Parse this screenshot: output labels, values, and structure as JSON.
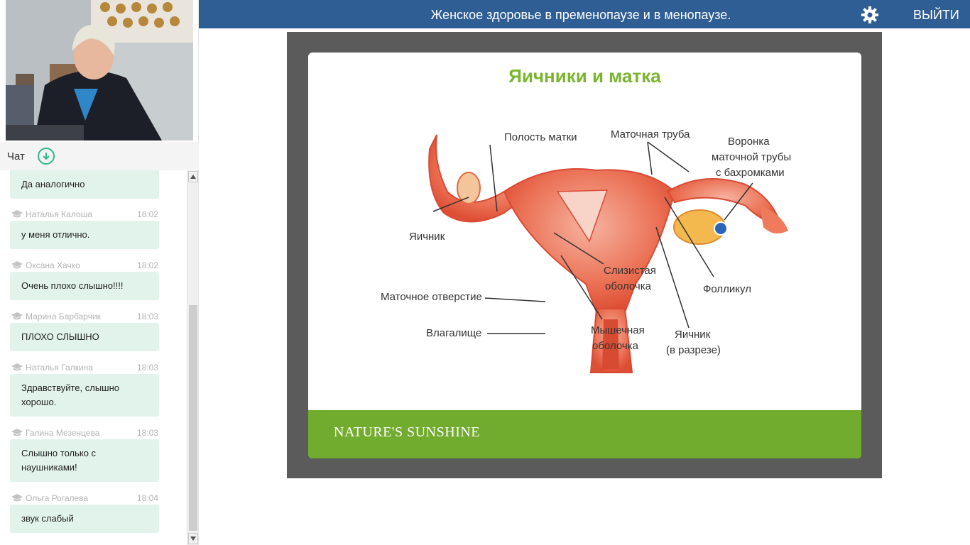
{
  "header": {
    "title": "Женское здоровье в пременопаузе и в менопаузе.",
    "logout_label": "ВЫЙТИ",
    "settings_icon": "gear-icon"
  },
  "chat": {
    "title": "Чат",
    "messages": [
      {
        "author": "",
        "time": "",
        "text": "Да аналогично"
      },
      {
        "author": "Наталья Калоша",
        "time": "18:02",
        "text": "у меня отлично."
      },
      {
        "author": "Оксана Хачко",
        "time": "18:02",
        "text": "Очень плохо слышно!!!!"
      },
      {
        "author": "Марина Барбарчик",
        "time": "18:03",
        "text": "ПЛОХО СЛЫШНО"
      },
      {
        "author": "Наталья Галкина",
        "time": "18:03",
        "text": "Здравствуйте, слышно хорошо."
      },
      {
        "author": "Галина Мезенцева",
        "time": "18:03",
        "text": "Слышно только с наушниками!"
      },
      {
        "author": "Ольга Рогалева",
        "time": "18:04",
        "text": "звук слабый"
      }
    ]
  },
  "slide": {
    "title": "Яичники и матка",
    "labels": {
      "cavity": "Полость матки",
      "tube": "Маточная труба",
      "funnel_1": "Воронка",
      "funnel_2": "маточной трубы",
      "funnel_3": "с бахромками",
      "ovary": "Яичник",
      "mucosa_1": "Слизистая",
      "mucosa_2": "оболочка",
      "follicle": "Фолликул",
      "opening": "Маточное отверстие",
      "vagina": "Влагалище",
      "muscle_1": "Мышечная",
      "muscle_2": "оболочка",
      "ovary_cut_1": "Яичник",
      "ovary_cut_2": "(в разрезе)"
    },
    "brand": "NATURE'S SUNSHINE",
    "brand_color": "#71ac2e"
  },
  "colors": {
    "topbar": "#2f5e94",
    "bubble": "#e2f3ec",
    "accent": "#2fb58b"
  }
}
